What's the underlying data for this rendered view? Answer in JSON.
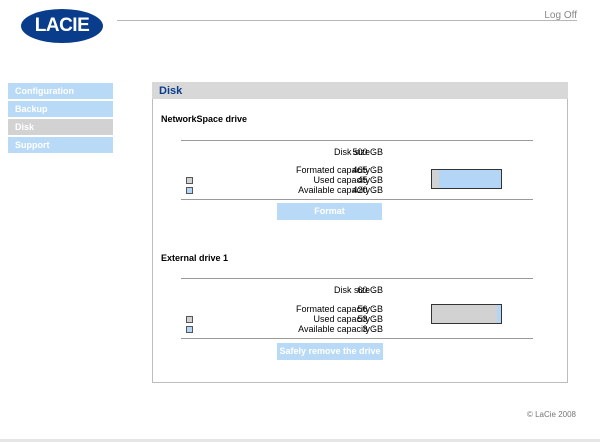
{
  "header": {
    "logo_text": "LACIE",
    "logoff_label": "Log Off"
  },
  "nav": {
    "items": [
      {
        "label": "Configuration",
        "active": false
      },
      {
        "label": "Backup",
        "active": false
      },
      {
        "label": "Disk",
        "active": true
      },
      {
        "label": "Support",
        "active": false
      }
    ]
  },
  "panel": {
    "title": "Disk"
  },
  "drives": [
    {
      "name": "NetworkSpace drive",
      "disk_size_label": "Disk size :",
      "disk_size": "500 GB",
      "formated_label": "Formated capacity :",
      "formated": "465 GB",
      "used_label": "Used capacity :",
      "used": "45 GB",
      "available_label": "Available capacity :",
      "available": "420 GB",
      "used_fraction": 0.097,
      "action_label": "Format"
    },
    {
      "name": "External drive 1",
      "disk_size_label": "Disk size :",
      "disk_size": "60 GB",
      "formated_label": "Formated capacity :",
      "formated": "56 GB",
      "used_label": "Used capacity :",
      "used": "53 GB",
      "available_label": "Available capacity :",
      "available": "3 GB",
      "used_fraction": 0.946,
      "action_label": "Safely remove the drive"
    }
  ],
  "footer": {
    "copyright": "© LaCie 2008"
  },
  "colors": {
    "brand_blue": "#0a3c8c",
    "nav_blue": "#b9daf7",
    "used_gray": "#d2d2d2",
    "available_blue": "#b4d6f6"
  }
}
